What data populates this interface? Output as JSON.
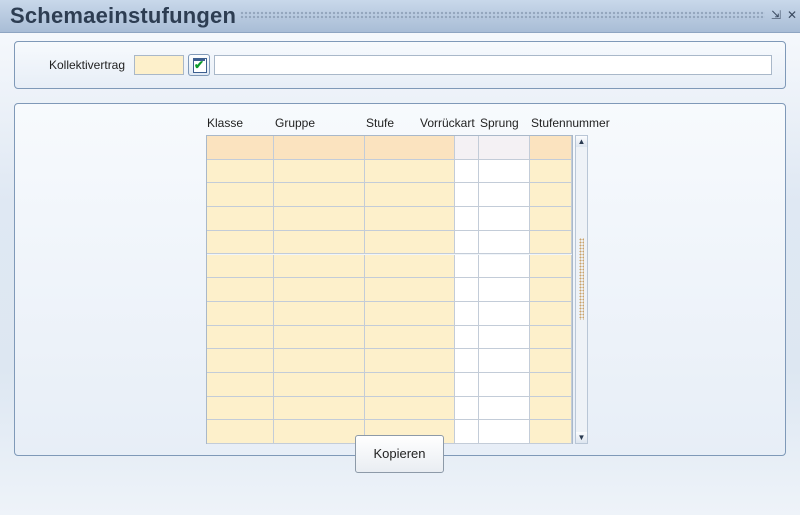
{
  "window": {
    "title": "Schemaeinstufungen",
    "minimize_glyph": "⇲",
    "close_glyph": "✕"
  },
  "filter": {
    "label": "Kollektivertrag",
    "code_value": "",
    "name_value": "",
    "pick_button_icon": "calendar-check-icon"
  },
  "table": {
    "columns": [
      "Klasse",
      "Gruppe",
      "Stufe",
      "Vorrückart",
      "Sprung",
      "Stufennummer"
    ],
    "row_count": 13,
    "rows": []
  },
  "scrollbar": {
    "up_glyph": "▲",
    "down_glyph": "▼"
  },
  "actions": {
    "copy_label": "Kopieren"
  },
  "colors": {
    "input_yellow": "#fdf0cb",
    "header_row": "#fbe3bf",
    "border": "#7f99b8",
    "title_text": "#2d3d52"
  }
}
